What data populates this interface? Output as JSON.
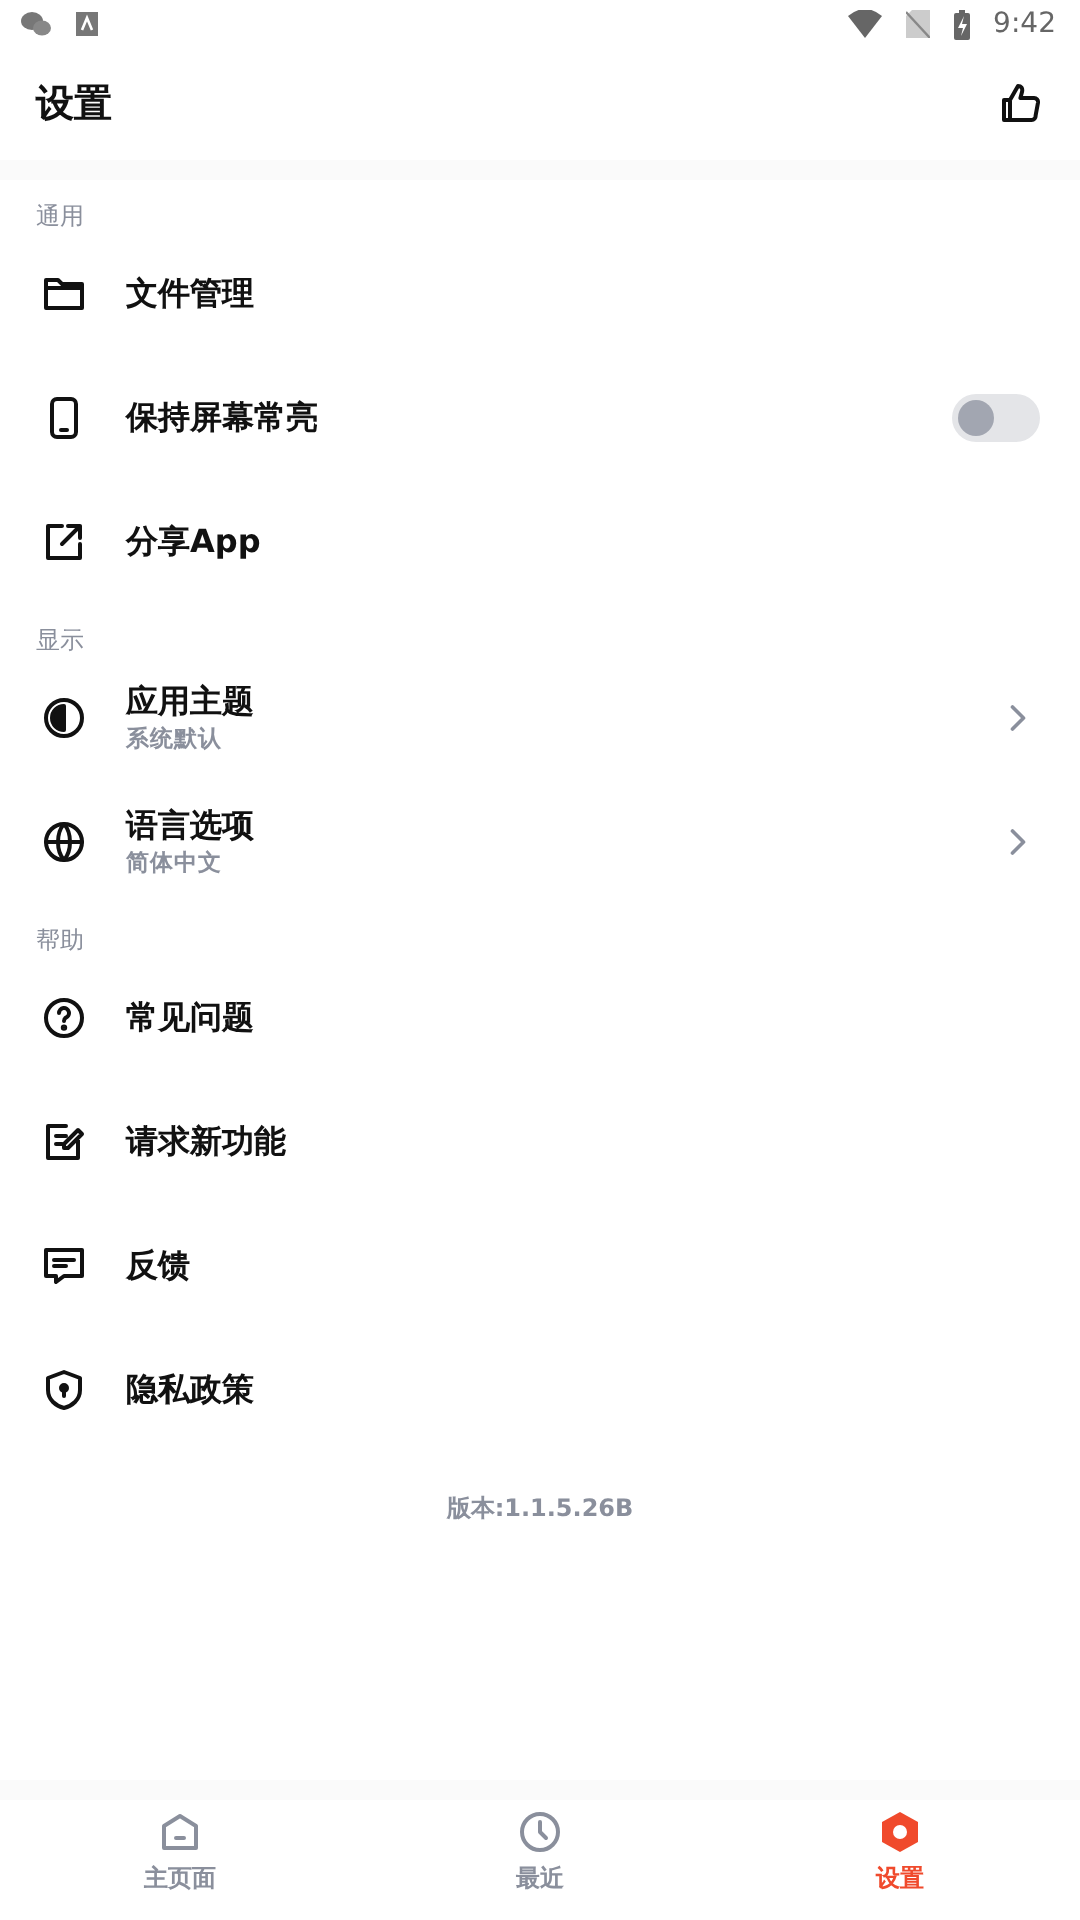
{
  "status_bar": {
    "time": "9:42"
  },
  "header": {
    "title": "设置"
  },
  "sections": [
    {
      "title": "通用",
      "items": [
        {
          "kind": "plain",
          "label": "文件管理"
        },
        {
          "kind": "toggle",
          "label": "保持屏幕常亮",
          "on": false
        },
        {
          "kind": "plain",
          "label": "分享App"
        }
      ]
    },
    {
      "title": "显示",
      "items": [
        {
          "kind": "nav",
          "label": "应用主题",
          "value": "系统默认"
        },
        {
          "kind": "nav",
          "label": "语言选项",
          "value": "简体中文"
        }
      ]
    },
    {
      "title": "帮助",
      "items": [
        {
          "kind": "plain",
          "label": "常见问题"
        },
        {
          "kind": "plain",
          "label": "请求新功能"
        },
        {
          "kind": "plain",
          "label": "反馈"
        },
        {
          "kind": "plain",
          "label": "隐私政策"
        }
      ]
    }
  ],
  "version": "版本:1.1.5.26B",
  "bottom_nav": [
    {
      "label": "主页面",
      "selected": false
    },
    {
      "label": "最近",
      "selected": false
    },
    {
      "label": "设置",
      "selected": true
    }
  ]
}
